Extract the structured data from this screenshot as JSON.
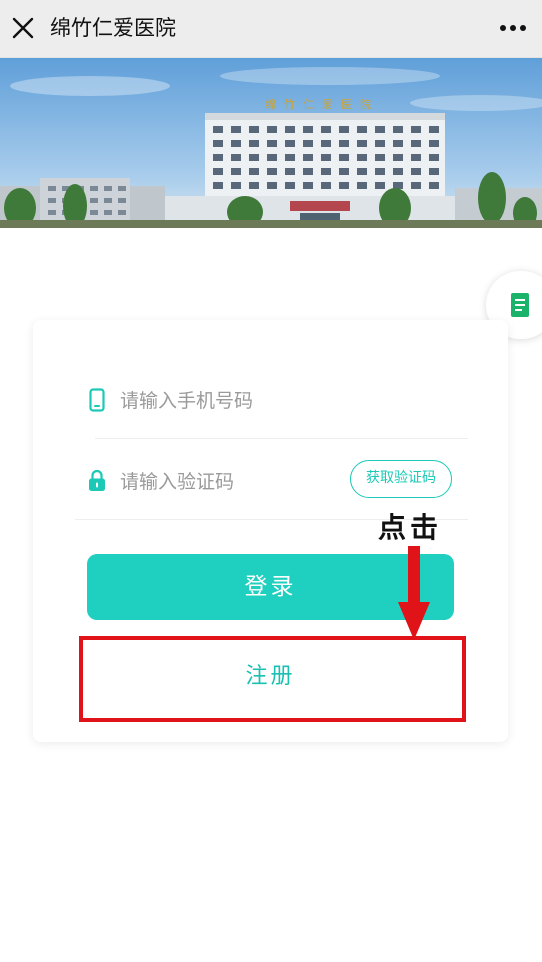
{
  "topbar": {
    "title": "绵竹仁爱医院",
    "close_icon": "close-icon",
    "more_icon": "more-icon"
  },
  "banner": {
    "image": "hospital-building-photo",
    "sign_text": "绵竹仁爱医院"
  },
  "float_tab": {
    "icon": "document-icon",
    "color": "#1bb36a"
  },
  "login_form": {
    "phone": {
      "icon": "phone-icon",
      "placeholder": "请输入手机号码",
      "value": ""
    },
    "code": {
      "icon": "lock-icon",
      "placeholder": "请输入验证码",
      "value": "",
      "get_code_label": "获取验证码"
    },
    "login_label": "登录",
    "register_label": "注册"
  },
  "annotation": {
    "text": "点击",
    "box_color": "#e01418",
    "arrow_color": "#e01418"
  },
  "colors": {
    "accent": "#1fcfbf",
    "accent_text": "#1bc0b2"
  }
}
